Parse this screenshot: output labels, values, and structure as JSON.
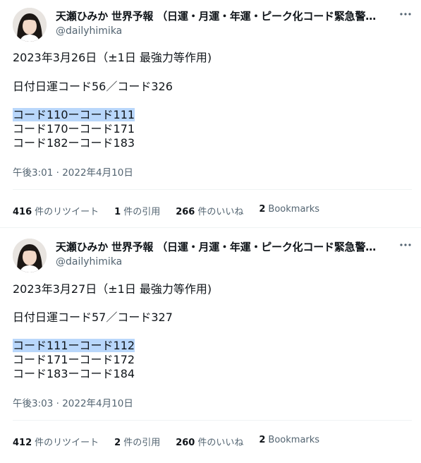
{
  "tweets": [
    {
      "author_name": "天瀬ひみか 世界予報 （日運・月運・年運・ピーク化コード緊急警…",
      "author_handle": "@dailyhimika",
      "more_icon": "ellipsis-icon",
      "lines": [
        "2023年3月26日（±1日 最強力等作用)",
        "日付日運コード56／コード326",
        "コード110ーコード111",
        "コード170ーコード171",
        "コード182ーコード183"
      ],
      "timestamp": "午後3:01 · 2022年4月10日",
      "stats": {
        "retweets_count": "416",
        "retweets_label": "件のリツイート",
        "quotes_count": "1",
        "quotes_label": "件の引用",
        "likes_count": "266",
        "likes_label": "件のいいね",
        "bookmarks_count": "2",
        "bookmarks_label": "Bookmarks"
      }
    },
    {
      "author_name": "天瀬ひみか 世界予報 （日運・月運・年運・ピーク化コード緊急警…",
      "author_handle": "@dailyhimika",
      "more_icon": "ellipsis-icon",
      "lines": [
        "2023年3月27日（±1日 最強力等作用)",
        "日付日運コード57／コード327",
        "コード111ーコード112",
        "コード171ーコード172",
        "コード183ーコード184"
      ],
      "timestamp": "午後3:03 · 2022年4月10日",
      "stats": {
        "retweets_count": "412",
        "retweets_label": "件のリツイート",
        "quotes_count": "2",
        "quotes_label": "件の引用",
        "likes_count": "260",
        "likes_label": "件のいいね",
        "bookmarks_count": "2",
        "bookmarks_label": "Bookmarks"
      }
    }
  ],
  "colors": {
    "highlight": "#b9d7fb",
    "secondary_text": "#536471",
    "primary_text": "#0f1419",
    "divider": "#eff3f4"
  }
}
